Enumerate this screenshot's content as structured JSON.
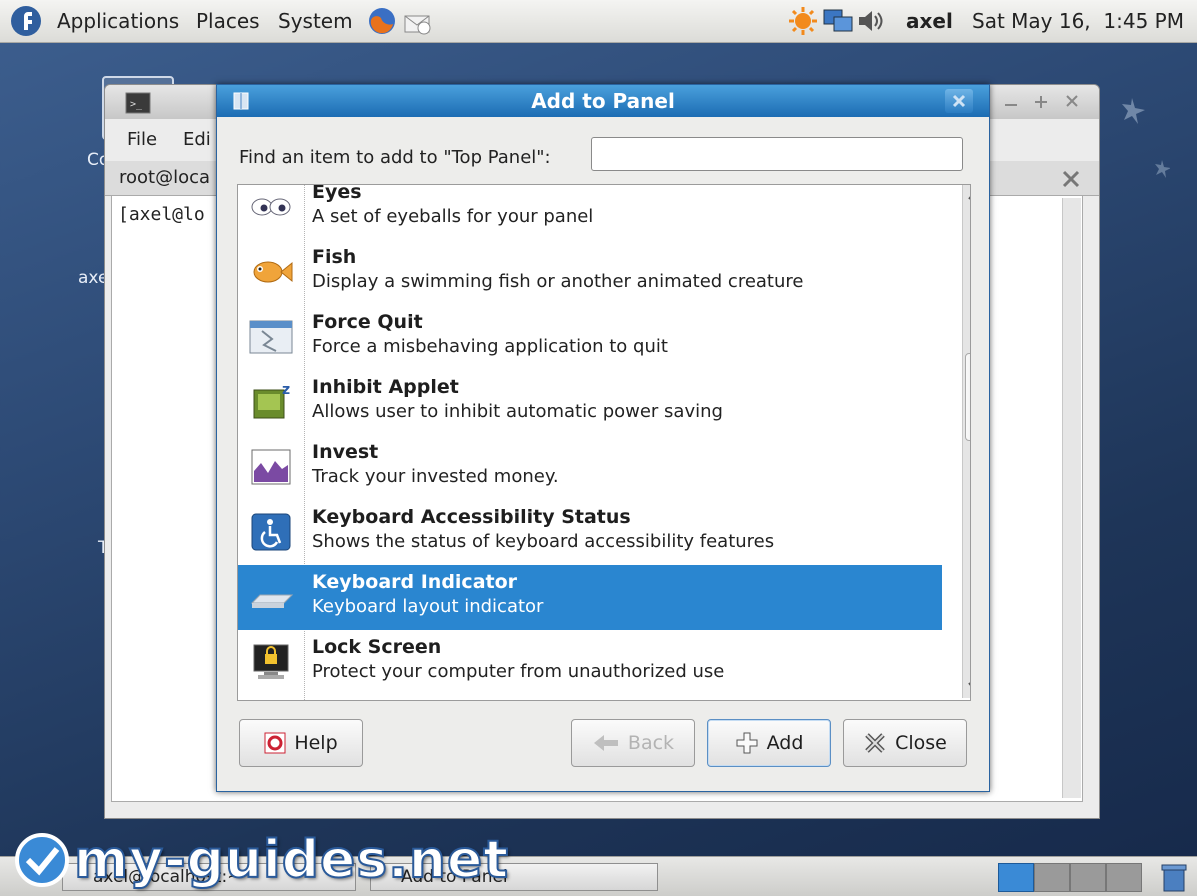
{
  "top_panel": {
    "menus": [
      "Applications",
      "Places",
      "System"
    ],
    "user": "axel",
    "clock": "Sat May 16,  1:45 PM"
  },
  "terminal": {
    "menu_file": "File",
    "menu_edit": "Edi",
    "tab_title": "root@loca",
    "prompt": "[axel@lo"
  },
  "desktop": {
    "label_c": "Co",
    "label_axe": "axe",
    "label_t": "T"
  },
  "dialog": {
    "title": "Add to Panel",
    "search_label": "Find an item to add to \"Top Panel\":",
    "search_value": "",
    "items": [
      {
        "title": "Eyes",
        "desc": "A set of eyeballs for your panel",
        "icon": "eyes-icon",
        "selected": false
      },
      {
        "title": "Fish",
        "desc": "Display a swimming fish or another animated creature",
        "icon": "fish-icon",
        "selected": false
      },
      {
        "title": "Force Quit",
        "desc": "Force a misbehaving application to quit",
        "icon": "force-quit-icon",
        "selected": false
      },
      {
        "title": "Inhibit Applet",
        "desc": "Allows user to inhibit automatic power saving",
        "icon": "inhibit-icon",
        "selected": false
      },
      {
        "title": "Invest",
        "desc": "Track your invested money.",
        "icon": "invest-icon",
        "selected": false
      },
      {
        "title": "Keyboard Accessibility Status",
        "desc": "Shows the status of keyboard accessibility features",
        "icon": "accessibility-icon",
        "selected": false
      },
      {
        "title": "Keyboard Indicator",
        "desc": "Keyboard layout indicator",
        "icon": "keyboard-icon",
        "selected": true
      },
      {
        "title": "Lock Screen",
        "desc": "Protect your computer from unauthorized use",
        "icon": "lock-screen-icon",
        "selected": false
      }
    ],
    "buttons": {
      "help": "Help",
      "back": "Back",
      "add": "Add",
      "close": "Close"
    }
  },
  "bottom_panel": {
    "tasks": [
      "axel@localhost:~",
      "Add to Panel"
    ]
  },
  "watermark": "my-guides.net",
  "colors": {
    "selection": "#2a86d0",
    "titlebar": "#1c6cb3"
  }
}
